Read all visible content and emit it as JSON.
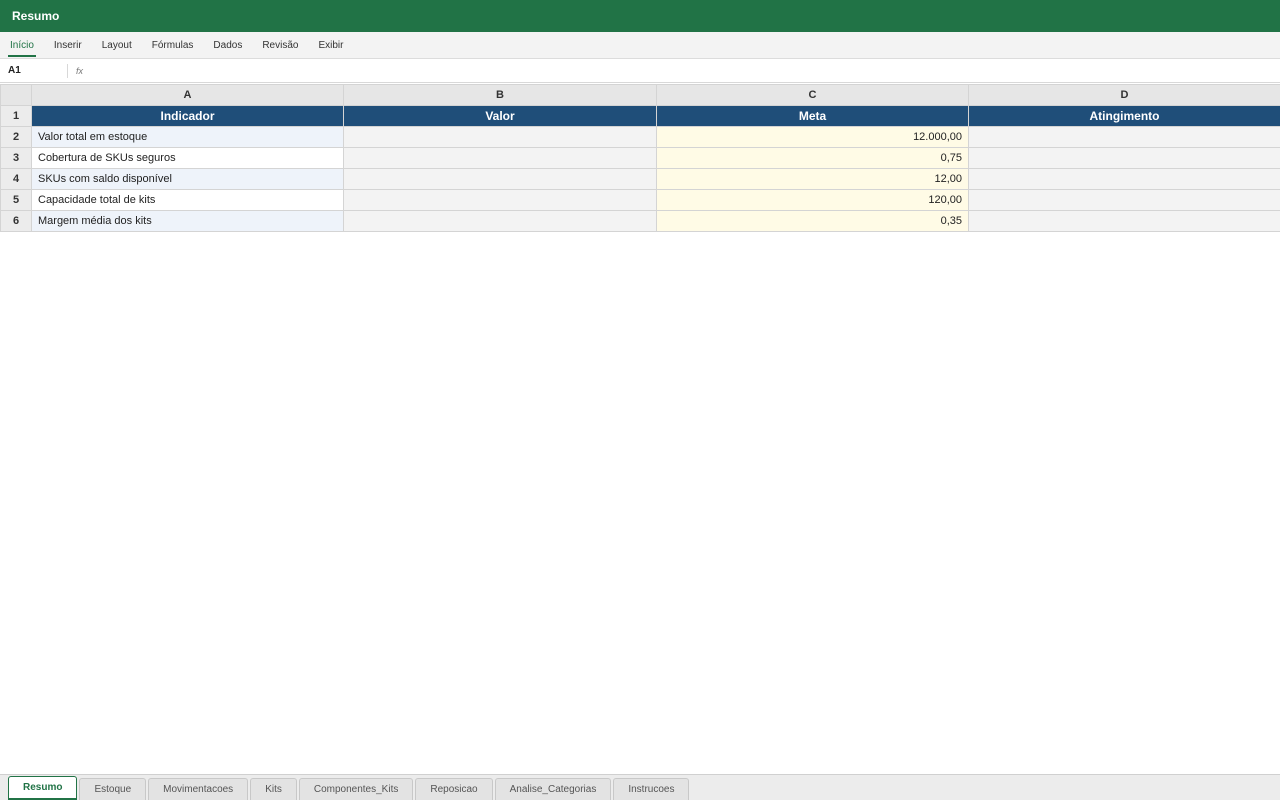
{
  "app": {
    "title": "Resumo"
  },
  "ribbon": {
    "tabs": [
      "Início",
      "Inserir",
      "Layout",
      "Fórmulas",
      "Dados",
      "Revisão",
      "Exibir"
    ],
    "active": "Início"
  },
  "formula_bar": {
    "cell_ref": "A1",
    "fx_label": "fx",
    "content": ""
  },
  "columns": [
    "A",
    "B",
    "C",
    "D"
  ],
  "header_row": {
    "number": "1",
    "cells": [
      "Indicador",
      "Valor",
      "Meta",
      "Atingimento"
    ]
  },
  "rows": [
    {
      "number": "2",
      "indicador": "Valor total em estoque",
      "valor": "",
      "meta": "12.000,00",
      "atingimento": ""
    },
    {
      "number": "3",
      "indicador": "Cobertura de SKUs seguros",
      "valor": "",
      "meta": "0,75",
      "atingimento": ""
    },
    {
      "number": "4",
      "indicador": "SKUs com saldo disponível",
      "valor": "",
      "meta": "12,00",
      "atingimento": ""
    },
    {
      "number": "5",
      "indicador": "Capacidade total de kits",
      "valor": "",
      "meta": "120,00",
      "atingimento": ""
    },
    {
      "number": "6",
      "indicador": "Margem média dos kits",
      "valor": "",
      "meta": "0,35",
      "atingimento": ""
    }
  ],
  "sheet_tabs": [
    "Resumo",
    "Estoque",
    "Movimentacoes",
    "Kits",
    "Componentes_Kits",
    "Reposicao",
    "Analise_Categorias",
    "Instrucoes"
  ],
  "active_sheet": "Resumo",
  "colors": {
    "title_bar": "#217346",
    "header_fill": "#1f4e79",
    "meta_fill": "#fffbe6"
  }
}
